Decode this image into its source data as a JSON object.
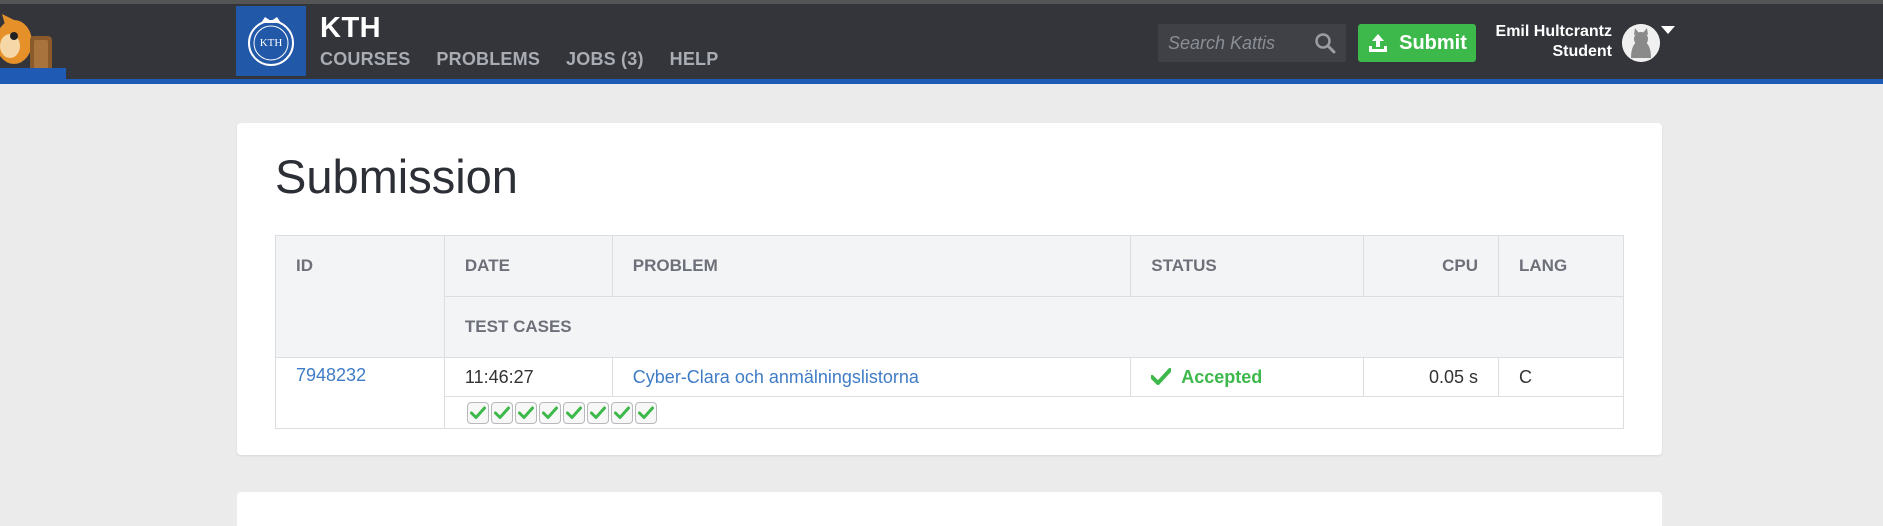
{
  "header": {
    "brand": "KTH",
    "nav": [
      "COURSES",
      "PROBLEMS",
      "JOBS (3)",
      "HELP"
    ],
    "search_placeholder": "Search Kattis",
    "submit_label": "Submit",
    "user_name": "Emil Hultcrantz",
    "user_role": "Student",
    "accent_color": "#1f5bb5",
    "submit_color": "#3db84a"
  },
  "main": {
    "title": "Submission",
    "table": {
      "headers": [
        "ID",
        "DATE",
        "PROBLEM",
        "STATUS",
        "CPU",
        "LANG"
      ],
      "subheader": "TEST CASES",
      "row": {
        "id": "7948232",
        "date": "11:46:27",
        "problem": "Cyber-Clara och anmälningslistorna",
        "status": "Accepted",
        "cpu": "0.05 s",
        "lang": "C"
      },
      "test_cases_passed": 8
    }
  }
}
